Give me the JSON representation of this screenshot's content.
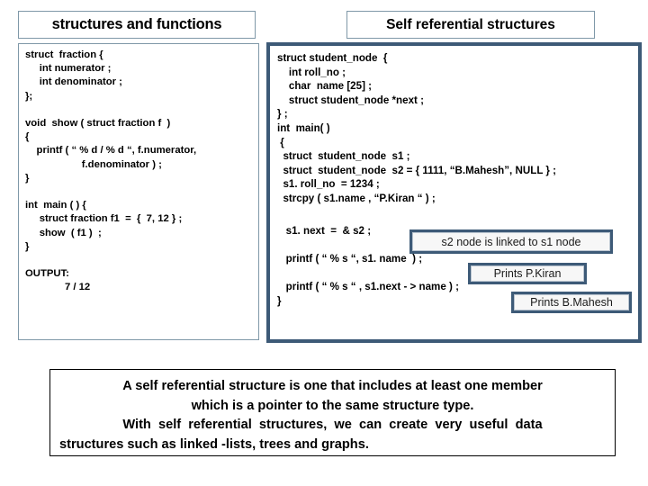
{
  "slide": {
    "left_section": {
      "title": "structures and functions",
      "code": "struct  fraction {\n     int numerator ;\n     int denominator ;\n};\n\nvoid  show ( struct fraction f  )\n{\n    printf ( “ % d / % d “, f.numerator,\n                    f.denominator ) ;\n}\n\nint  main ( ) {\n     struct fraction f1  =  {  7, 12 } ;\n     show  ( f1 )  ;\n}\n\nOUTPUT:\n              7 / 12"
    },
    "right_section": {
      "title": "Self referential structures",
      "code_part1": "struct student_node  {\n    int roll_no ;\n    char  name [25] ;\n    struct student_node *next ;\n} ;\nint  main( )\n {\n  struct  student_node  s1 ;\n  struct  student_node  s2 = { 1111, “B.Mahesh”, NULL } ;\n  s1. roll_no  = 1234 ;\n  strcpy ( s1.name , “P.Kiran “ ) ;",
      "code_part2": "   s1. next  =  & s2 ;\n\n   printf ( “ % s “, s1. name  ) ;\n\n   printf ( “ % s “ , s1.next - > name ) ;\n}",
      "callouts": [
        {
          "id": "s2-link",
          "text": "s2 node is linked to s1 node"
        },
        {
          "id": "prints-kiran",
          "text": "Prints P.Kiran"
        },
        {
          "id": "prints-mahesh",
          "text": "Prints B.Mahesh"
        }
      ]
    },
    "summary": {
      "line1": "A self referential structure is one that includes at least one member",
      "line2": "which is a pointer to the same structure type.",
      "line3": "With  self  referential  structures,  we  can  create  very  useful  data",
      "line4": "structures such as linked -lists, trees and graphs."
    },
    "colors": {
      "thin_border": "#7f98a8",
      "thick_border": "#3d5a77",
      "callout_fill": "#f2f2f2",
      "text": "#000000",
      "background": "#ffffff"
    }
  }
}
